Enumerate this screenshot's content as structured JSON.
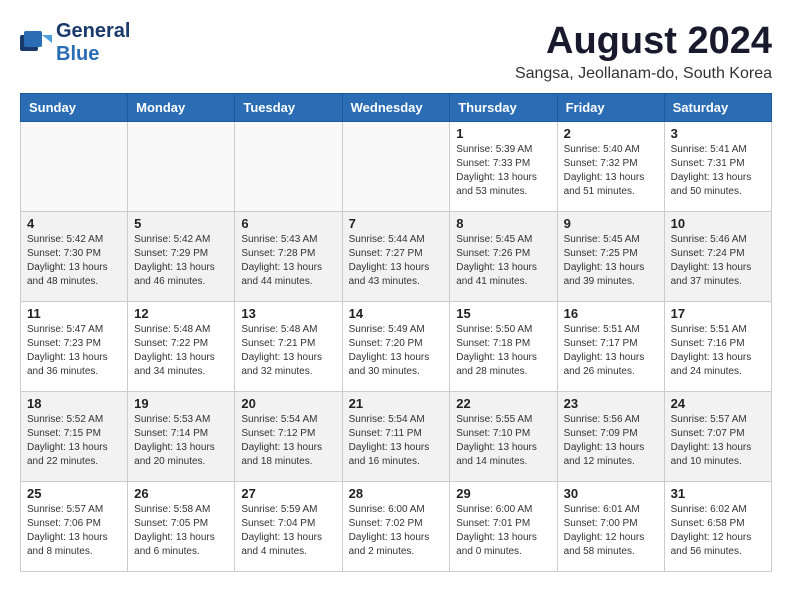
{
  "logo": {
    "general": "General",
    "blue": "Blue"
  },
  "title": {
    "month_year": "August 2024",
    "location": "Sangsa, Jeollanam-do, South Korea"
  },
  "days_header": [
    "Sunday",
    "Monday",
    "Tuesday",
    "Wednesday",
    "Thursday",
    "Friday",
    "Saturday"
  ],
  "weeks": [
    [
      {
        "day": "",
        "info": ""
      },
      {
        "day": "",
        "info": ""
      },
      {
        "day": "",
        "info": ""
      },
      {
        "day": "",
        "info": ""
      },
      {
        "day": "1",
        "info": "Sunrise: 5:39 AM\nSunset: 7:33 PM\nDaylight: 13 hours\nand 53 minutes."
      },
      {
        "day": "2",
        "info": "Sunrise: 5:40 AM\nSunset: 7:32 PM\nDaylight: 13 hours\nand 51 minutes."
      },
      {
        "day": "3",
        "info": "Sunrise: 5:41 AM\nSunset: 7:31 PM\nDaylight: 13 hours\nand 50 minutes."
      }
    ],
    [
      {
        "day": "4",
        "info": "Sunrise: 5:42 AM\nSunset: 7:30 PM\nDaylight: 13 hours\nand 48 minutes."
      },
      {
        "day": "5",
        "info": "Sunrise: 5:42 AM\nSunset: 7:29 PM\nDaylight: 13 hours\nand 46 minutes."
      },
      {
        "day": "6",
        "info": "Sunrise: 5:43 AM\nSunset: 7:28 PM\nDaylight: 13 hours\nand 44 minutes."
      },
      {
        "day": "7",
        "info": "Sunrise: 5:44 AM\nSunset: 7:27 PM\nDaylight: 13 hours\nand 43 minutes."
      },
      {
        "day": "8",
        "info": "Sunrise: 5:45 AM\nSunset: 7:26 PM\nDaylight: 13 hours\nand 41 minutes."
      },
      {
        "day": "9",
        "info": "Sunrise: 5:45 AM\nSunset: 7:25 PM\nDaylight: 13 hours\nand 39 minutes."
      },
      {
        "day": "10",
        "info": "Sunrise: 5:46 AM\nSunset: 7:24 PM\nDaylight: 13 hours\nand 37 minutes."
      }
    ],
    [
      {
        "day": "11",
        "info": "Sunrise: 5:47 AM\nSunset: 7:23 PM\nDaylight: 13 hours\nand 36 minutes."
      },
      {
        "day": "12",
        "info": "Sunrise: 5:48 AM\nSunset: 7:22 PM\nDaylight: 13 hours\nand 34 minutes."
      },
      {
        "day": "13",
        "info": "Sunrise: 5:48 AM\nSunset: 7:21 PM\nDaylight: 13 hours\nand 32 minutes."
      },
      {
        "day": "14",
        "info": "Sunrise: 5:49 AM\nSunset: 7:20 PM\nDaylight: 13 hours\nand 30 minutes."
      },
      {
        "day": "15",
        "info": "Sunrise: 5:50 AM\nSunset: 7:18 PM\nDaylight: 13 hours\nand 28 minutes."
      },
      {
        "day": "16",
        "info": "Sunrise: 5:51 AM\nSunset: 7:17 PM\nDaylight: 13 hours\nand 26 minutes."
      },
      {
        "day": "17",
        "info": "Sunrise: 5:51 AM\nSunset: 7:16 PM\nDaylight: 13 hours\nand 24 minutes."
      }
    ],
    [
      {
        "day": "18",
        "info": "Sunrise: 5:52 AM\nSunset: 7:15 PM\nDaylight: 13 hours\nand 22 minutes."
      },
      {
        "day": "19",
        "info": "Sunrise: 5:53 AM\nSunset: 7:14 PM\nDaylight: 13 hours\nand 20 minutes."
      },
      {
        "day": "20",
        "info": "Sunrise: 5:54 AM\nSunset: 7:12 PM\nDaylight: 13 hours\nand 18 minutes."
      },
      {
        "day": "21",
        "info": "Sunrise: 5:54 AM\nSunset: 7:11 PM\nDaylight: 13 hours\nand 16 minutes."
      },
      {
        "day": "22",
        "info": "Sunrise: 5:55 AM\nSunset: 7:10 PM\nDaylight: 13 hours\nand 14 minutes."
      },
      {
        "day": "23",
        "info": "Sunrise: 5:56 AM\nSunset: 7:09 PM\nDaylight: 13 hours\nand 12 minutes."
      },
      {
        "day": "24",
        "info": "Sunrise: 5:57 AM\nSunset: 7:07 PM\nDaylight: 13 hours\nand 10 minutes."
      }
    ],
    [
      {
        "day": "25",
        "info": "Sunrise: 5:57 AM\nSunset: 7:06 PM\nDaylight: 13 hours\nand 8 minutes."
      },
      {
        "day": "26",
        "info": "Sunrise: 5:58 AM\nSunset: 7:05 PM\nDaylight: 13 hours\nand 6 minutes."
      },
      {
        "day": "27",
        "info": "Sunrise: 5:59 AM\nSunset: 7:04 PM\nDaylight: 13 hours\nand 4 minutes."
      },
      {
        "day": "28",
        "info": "Sunrise: 6:00 AM\nSunset: 7:02 PM\nDaylight: 13 hours\nand 2 minutes."
      },
      {
        "day": "29",
        "info": "Sunrise: 6:00 AM\nSunset: 7:01 PM\nDaylight: 13 hours\nand 0 minutes."
      },
      {
        "day": "30",
        "info": "Sunrise: 6:01 AM\nSunset: 7:00 PM\nDaylight: 12 hours\nand 58 minutes."
      },
      {
        "day": "31",
        "info": "Sunrise: 6:02 AM\nSunset: 6:58 PM\nDaylight: 12 hours\nand 56 minutes."
      }
    ]
  ]
}
